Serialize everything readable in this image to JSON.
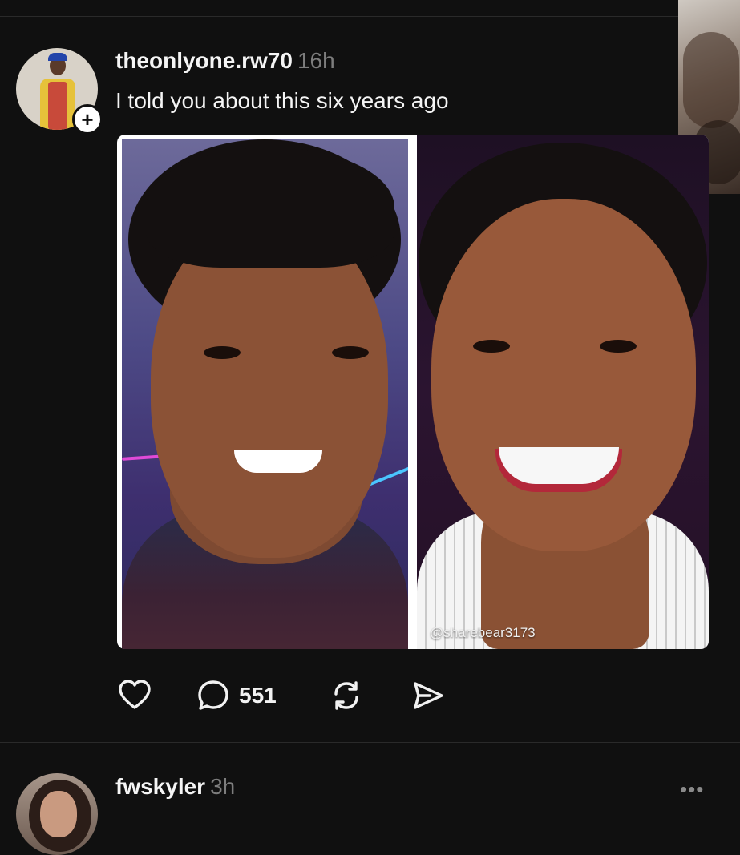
{
  "post1": {
    "username": "theonlyone.rw70",
    "timestamp": "16h",
    "text": "I told you about this six years ago",
    "image_watermark": "@sharebear3173",
    "reply_count": "551"
  },
  "post2": {
    "username": "fwskyler",
    "timestamp": "3h"
  },
  "icons": {
    "follow": "plus-icon",
    "like": "heart-icon",
    "reply": "comment-icon",
    "repost": "repost-icon",
    "share": "send-icon",
    "more": "more-icon"
  },
  "colors": {
    "background": "#101010",
    "text_primary": "#f5f5f5",
    "text_secondary": "#7d7d7d",
    "divider": "#2a2a2a"
  }
}
